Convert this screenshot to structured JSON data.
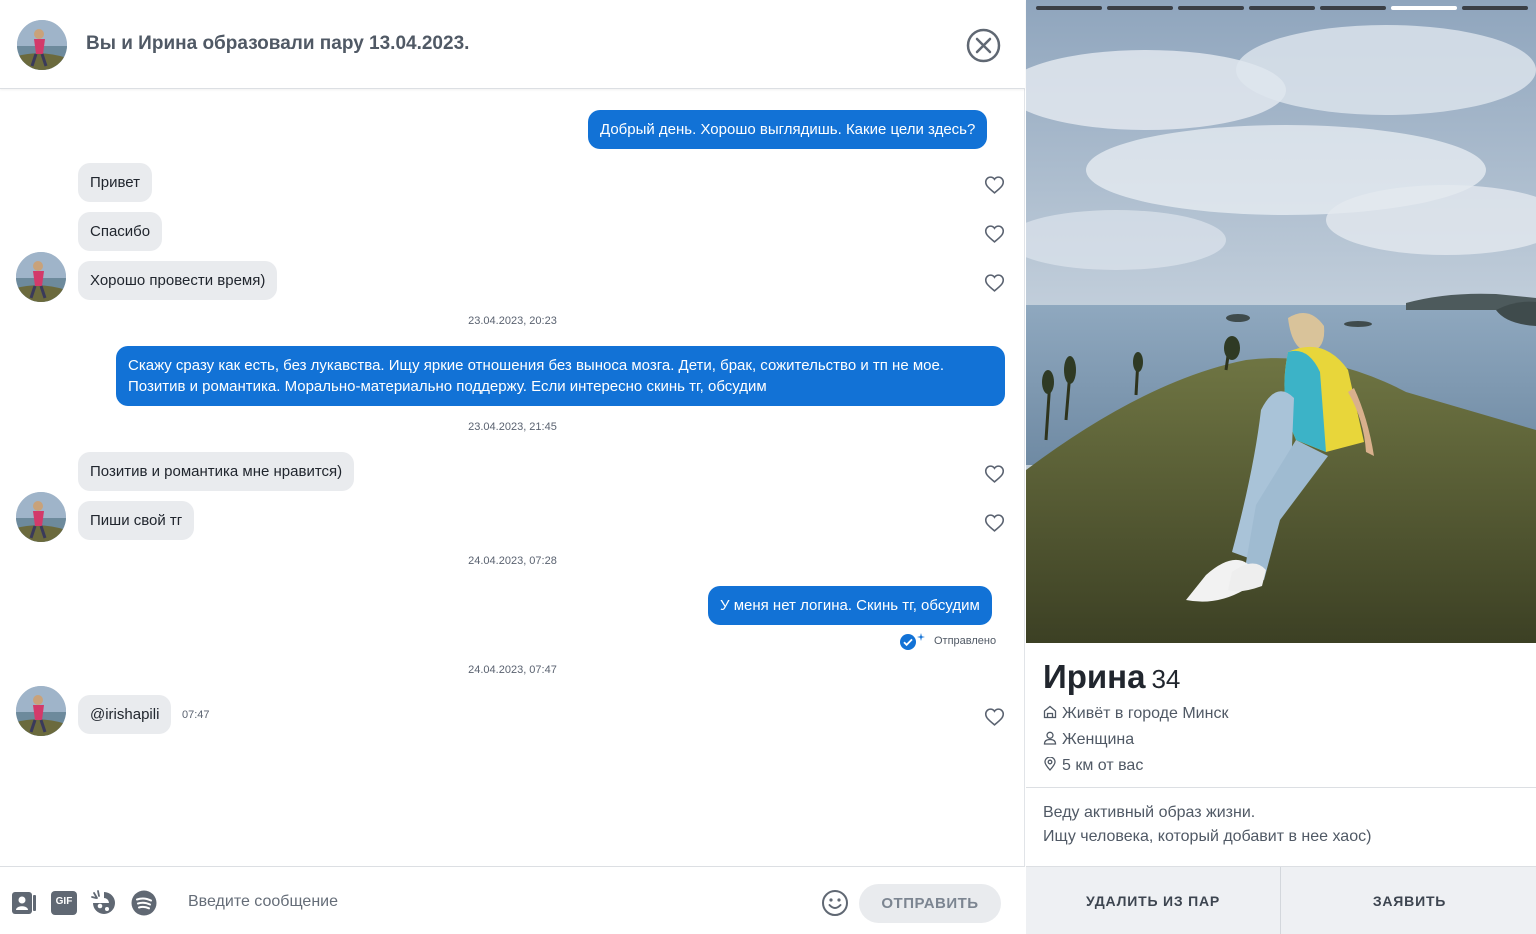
{
  "header": {
    "title": "Вы и Ирина образовали пару 13.04.2023."
  },
  "messages": [
    {
      "dir": "out",
      "text": "Добрый день. Хорошо выглядишь. Какие цели здесь?"
    },
    {
      "dir": "in",
      "text": "Привет"
    },
    {
      "dir": "in",
      "text": "Спасибо"
    },
    {
      "dir": "in",
      "text": "Хорошо провести время)"
    },
    {
      "dir": "stamp",
      "text": "23.04.2023, 20:23"
    },
    {
      "dir": "out",
      "text": "Скажу сразу как есть, без лукавства. Ищу яркие отношения без выноса мозга. Дети, брак, сожительство и тп не мое. Позитив и романтика. Морально-материально поддержу. Если интересно скинь тг, обсудим"
    },
    {
      "dir": "stamp",
      "text": "23.04.2023, 21:45"
    },
    {
      "dir": "in",
      "text": "Позитив и романтика мне нравится)"
    },
    {
      "dir": "in",
      "text": "Пиши свой тг"
    },
    {
      "dir": "stamp",
      "text": "24.04.2023, 07:28"
    },
    {
      "dir": "out",
      "text": "У меня нет логина. Скинь тг, обсудим",
      "status": "Отправлено"
    },
    {
      "dir": "stamp",
      "text": "24.04.2023, 07:47"
    },
    {
      "dir": "in",
      "text": "@irishapili",
      "time": "07:47"
    }
  ],
  "composer": {
    "placeholder": "Введите сообщение",
    "send_label": "ОТПРАВИТЬ",
    "gif_label": "GIF"
  },
  "profile": {
    "name": "Ирина",
    "age": "34",
    "photo_count": 7,
    "photo_index": 6,
    "city": "Живёт в городе Минск",
    "gender": "Женщина",
    "distance": "5 км от вас",
    "bio_line1": "Веду активный образ жизни.",
    "bio_line2": "Ищу человека, который добавит в нее хаос)",
    "unmatch_label": "УДАЛИТЬ ИЗ ПАР",
    "report_label": "ЗАЯВИТЬ"
  },
  "colors": {
    "outgoing_bubble": "#1272d6",
    "incoming_bubble": "#e9ebee",
    "accent": "#1272d6"
  }
}
